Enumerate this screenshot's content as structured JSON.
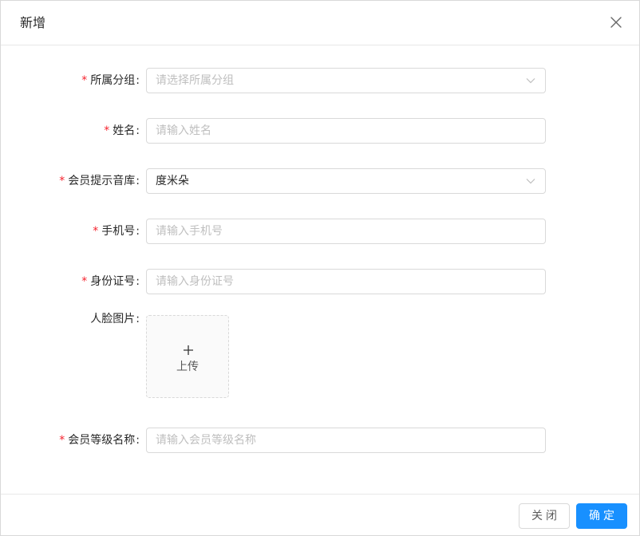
{
  "modal": {
    "title": "新增",
    "close_icon": "close-icon"
  },
  "form": {
    "required_mark": "*",
    "colon": ":",
    "group": {
      "label": "所属分组",
      "placeholder": "请选择所属分组",
      "required": true
    },
    "name": {
      "label": "姓名",
      "placeholder": "请输入姓名",
      "required": true
    },
    "voice_library": {
      "label": "会员提示音库",
      "value": "度米朵",
      "required": true
    },
    "phone": {
      "label": "手机号",
      "placeholder": "请输入手机号",
      "required": true
    },
    "id_number": {
      "label": "身份证号",
      "placeholder": "请输入身份证号",
      "required": true
    },
    "face_image": {
      "label": "人脸图片",
      "upload_label": "上传",
      "required": false
    },
    "member_level": {
      "label": "会员等级名称",
      "placeholder": "请输入会员等级名称",
      "required": true
    }
  },
  "footer": {
    "close_label": "关闭",
    "confirm_label": "确定"
  },
  "colors": {
    "primary": "#1890ff",
    "required": "#f5222d",
    "border": "#d9d9d9",
    "placeholder": "#bfbfbf"
  }
}
